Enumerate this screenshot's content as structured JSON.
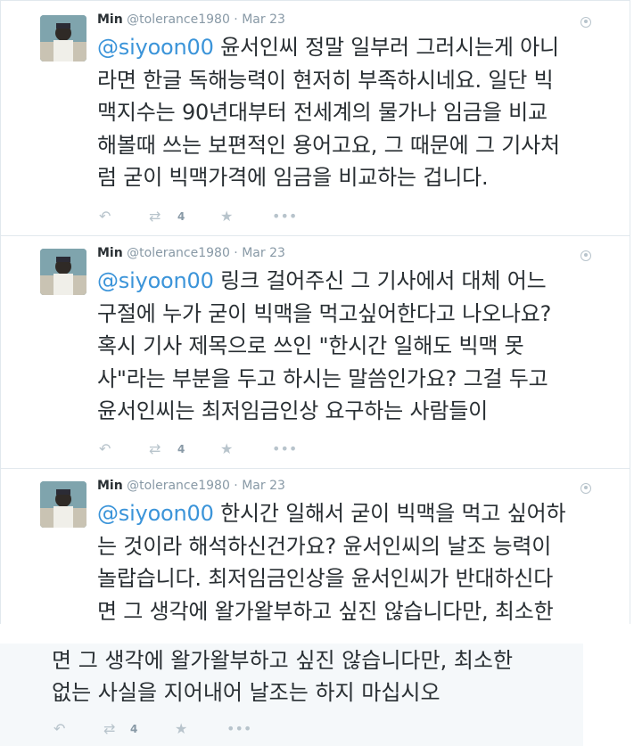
{
  "tweets": [
    {
      "name": "Min",
      "meta": "@tolerance1980 · Mar 23",
      "mention": "@siyoon00",
      "lines": [
        " 윤서인씨 정말 일부러 그러시는게 아니",
        "라면 한글 독해능력이 현저히 부족하시네요. 일단 빅",
        "맥지수는 90년대부터 전세계의 물가나 임금을 비교",
        "해볼때 쓰는 보편적인 용어고요, 그 때문에 그 기사처",
        "럼 굳이 빅맥가격에 임금을 비교하는 겁니다."
      ],
      "retweet_count": "4"
    },
    {
      "name": "Min",
      "meta": "@tolerance1980 · Mar 23",
      "mention": "@siyoon00",
      "lines": [
        " 링크 걸어주신 그 기사에서 대체 어느",
        "구절에 누가 굳이 빅맥을 먹고싶어한다고 나오나요?",
        "혹시 기사 제목으로 쓰인 \"한시간 일해도 빅맥 못",
        "사\"라는 부분을 두고 하시는 말씀인가요? 그걸 두고",
        "윤서인씨는 최저임금인상 요구하는 사람들이"
      ],
      "retweet_count": "4"
    },
    {
      "name": "Min",
      "meta": "@tolerance1980 · Mar 23",
      "mention": "@siyoon00",
      "lines": [
        " 한시간 일해서 굳이 빅맥을 먹고 싶어하",
        "는 것이라 해석하신건가요? 윤서인씨의 날조 능력이",
        "놀랍습니다. 최저임금인상을 윤서인씨가 반대하신다",
        "면 그 생각에 왈가왈부하고 싶진 않습니다만, 최소한"
      ],
      "retweet_count": "4"
    }
  ],
  "patch": {
    "lines": [
      "면 그 생각에 왈가왈부하고 싶진 않습니다만, 최소한",
      "없는 사실을 지어내어 날조는 하지 마십시오"
    ],
    "retweet_count": "4"
  },
  "icons": {
    "reply": "reply-icon",
    "retweet": "retweet-icon",
    "favorite": "star-icon",
    "more": "more-icon",
    "globe": "globe-icon"
  },
  "colors": {
    "mention": "#3b94d9",
    "text": "#292f33",
    "meta": "#8899a6",
    "action": "#b8c4cc"
  }
}
